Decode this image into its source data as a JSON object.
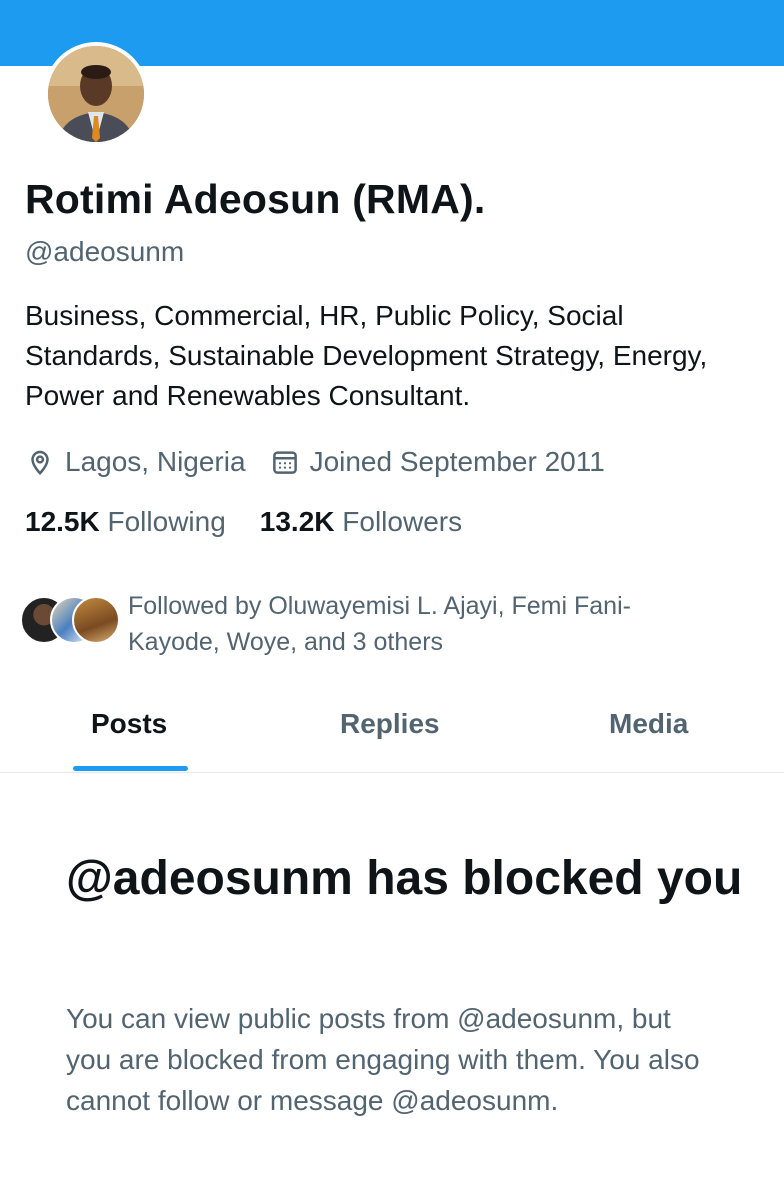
{
  "colors": {
    "accent": "#1d9bf0",
    "text_primary": "#0f1419",
    "text_secondary": "#536471",
    "divider": "#e6e9eb"
  },
  "profile": {
    "display_name": "Rotimi Adeosun (RMA).",
    "handle": "@adeosunm",
    "bio": "Business, Commercial, HR, Public Policy, Social Standards, Sustainable Development Strategy, Energy, Power and Renewables Consultant.",
    "location": "Lagos, Nigeria",
    "location_icon": "location-pin-icon",
    "joined": "Joined September 2011",
    "joined_icon": "calendar-icon"
  },
  "stats": {
    "following_count": "12.5K",
    "following_label": "Following",
    "followers_count": "13.2K",
    "followers_label": "Followers"
  },
  "followed_by": {
    "text": "Followed by Oluwayemisi L. Ajayi, Femi Fani-Kayode, Woye, and 3 others"
  },
  "tabs": [
    {
      "label": "Posts",
      "active": true
    },
    {
      "label": "Replies",
      "active": false
    },
    {
      "label": "Media",
      "active": false
    }
  ],
  "blocked": {
    "title": "@adeosunm has blocked you",
    "message": "You can view public posts from @adeosunm, but you are blocked from engaging with them. You also cannot follow or message @adeosunm."
  }
}
